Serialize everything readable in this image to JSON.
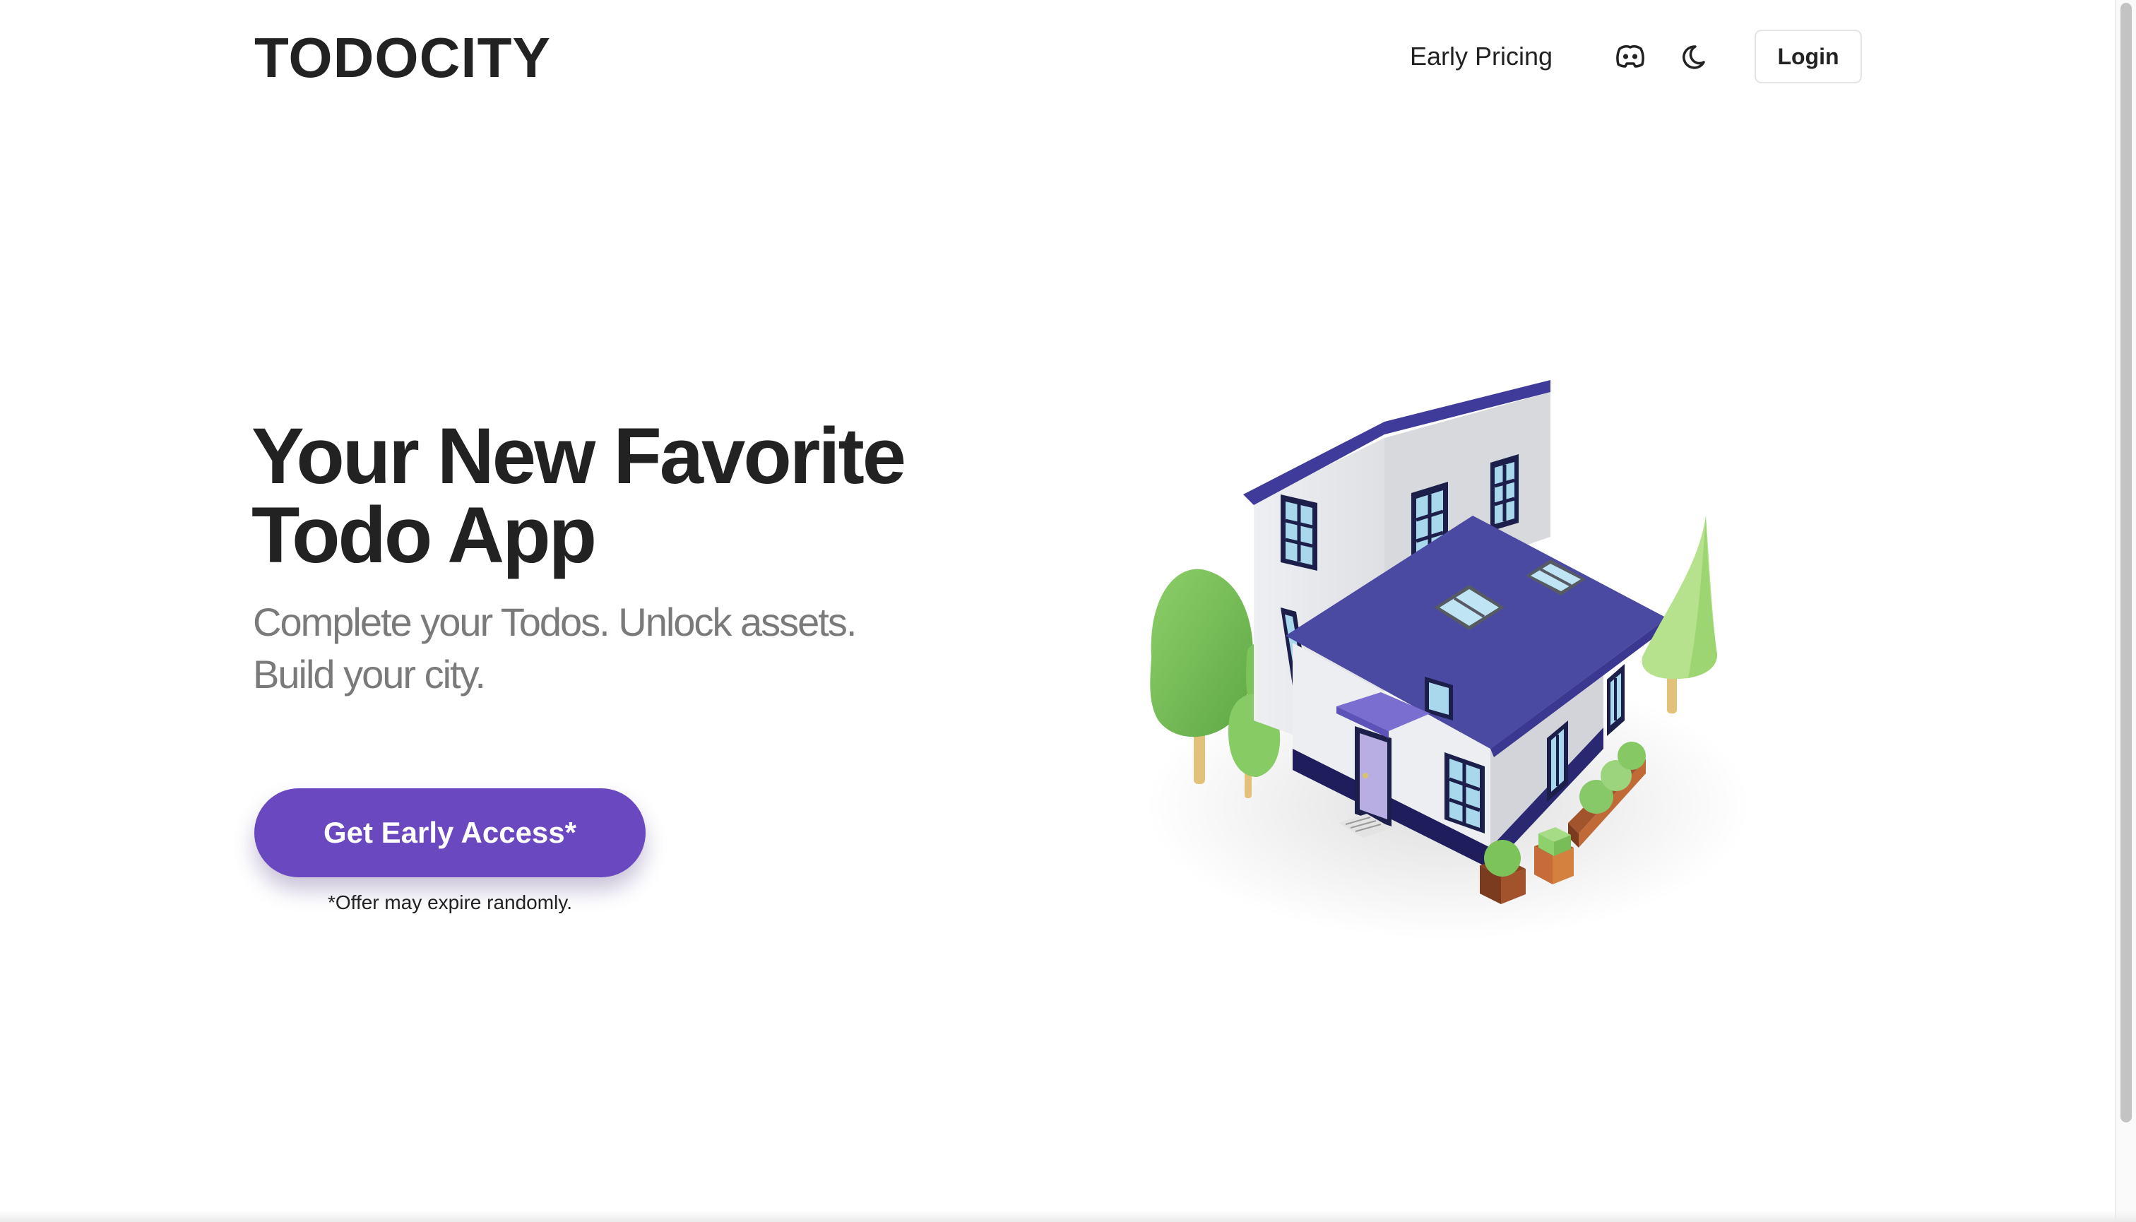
{
  "header": {
    "logo": "TODOCITY",
    "nav_link": "Early Pricing",
    "discord_icon": "discord-icon",
    "theme_icon": "moon-icon",
    "login_label": "Login"
  },
  "hero": {
    "title_line1": "Your New Favorite",
    "title_line2": "Todo App",
    "subtitle_line1": "Complete your Todos. Unlock assets.",
    "subtitle_line2": "Build your city.",
    "cta_label": "Get Early Access*",
    "cta_note": "*Offer may expire randomly."
  },
  "illustration": {
    "icon": "isometric-house-illustration"
  },
  "colors": {
    "brand_purple": "#6a48c0",
    "roof_purple": "#4b4aa3",
    "text_dark": "#222222",
    "text_muted": "#7a7a7a",
    "tree_green": "#7cbf5a"
  }
}
